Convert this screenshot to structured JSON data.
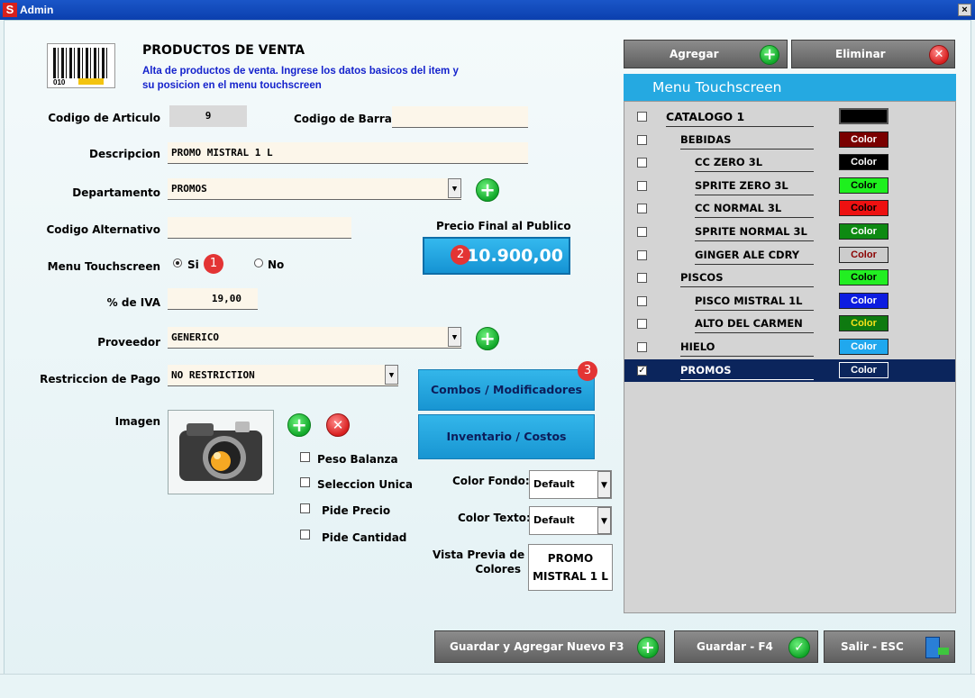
{
  "window": {
    "title": "Admin",
    "close": "×"
  },
  "header": {
    "title": "PRODUCTOS DE VENTA",
    "subtitle": "Alta de productos de venta. Ingrese los datos basicos del item y su posicion en el menu touchscreen",
    "barcode_number": "010"
  },
  "form": {
    "codigo_articulo_label": "Codigo de Articulo",
    "codigo_articulo_value": "9",
    "codigo_barras_label": "Codigo de Barras",
    "codigo_barras_value": "",
    "descripcion_label": "Descripcion",
    "descripcion_value": "PROMO MISTRAL 1 L",
    "departamento_label": "Departamento",
    "departamento_value": "PROMOS",
    "codigo_alternativo_label": "Codigo Alternativo",
    "codigo_alternativo_value": "",
    "precio_label": "Precio Final al Publico",
    "precio_value": "10.900,00",
    "menu_touch_label": "Menu Touchscreen",
    "radio_si": "Si",
    "radio_no": "No",
    "iva_label": "% de IVA",
    "iva_value": "19,00",
    "proveedor_label": "Proveedor",
    "proveedor_value": "GENERICO",
    "restriccion_label": "Restriccion de Pago",
    "restriccion_value": "NO RESTRICTION",
    "imagen_label": "Imagen",
    "combos_button": "Combos /  Modificadores",
    "inventario_button": "Inventario / Costos",
    "checkboxes": [
      "Peso Balanza",
      "Seleccion Unica",
      "Pide Precio",
      "Pide Cantidad"
    ],
    "color_fondo_label": "Color Fondo:",
    "color_fondo_value": "Default",
    "color_texto_label": "Color Texto:",
    "color_texto_value": "Default",
    "vista_previa_label_1": "Vista Previa de",
    "vista_previa_label_2": "Colores",
    "preview_line1": "PROMO",
    "preview_line2": "MISTRAL 1 L"
  },
  "badges": [
    "1",
    "2",
    "3"
  ],
  "right_panel": {
    "agregar": "Agregar",
    "eliminar": "Eliminar",
    "menu_title": "Menu Touchscreen",
    "color_button_label": "Color",
    "items": [
      {
        "label": "CATALOGO 1",
        "level": 0,
        "color": "#000000",
        "text_color": "#000000",
        "checked": false
      },
      {
        "label": "BEBIDAS",
        "level": 1,
        "color": "#7a0000",
        "text_color": "#ffffff",
        "checked": false
      },
      {
        "label": "CC ZERO 3L",
        "level": 2,
        "color": "#000000",
        "text_color": "#ffffff",
        "checked": false
      },
      {
        "label": "SPRITE ZERO 3L",
        "level": 2,
        "color": "#1ef01e",
        "text_color": "#000000",
        "checked": false
      },
      {
        "label": "CC NORMAL 3L",
        "level": 2,
        "color": "#ee1111",
        "text_color": "#000000",
        "checked": false
      },
      {
        "label": "SPRITE NORMAL 3L",
        "level": 2,
        "color": "#0d8a12",
        "text_color": "#ffffff",
        "checked": false
      },
      {
        "label": "GINGER ALE CDRY",
        "level": 2,
        "color": "#cccccc",
        "text_color": "#8a0000",
        "checked": false
      },
      {
        "label": "PISCOS",
        "level": 1,
        "color": "#22ee22",
        "text_color": "#000000",
        "checked": false
      },
      {
        "label": "PISCO MISTRAL 1L",
        "level": 2,
        "color": "#0c1ce0",
        "text_color": "#ffffff",
        "checked": false
      },
      {
        "label": "ALTO DEL CARMEN",
        "level": 2,
        "color": "#0e7a10",
        "text_color": "#f7e21a",
        "checked": false
      },
      {
        "label": "HIELO",
        "level": 1,
        "color": "#20a8ee",
        "text_color": "#ffffff",
        "checked": false
      },
      {
        "label": "PROMOS",
        "level": 1,
        "color": "#0b255c",
        "text_color": "#ffffff",
        "checked": true,
        "selected": true
      }
    ]
  },
  "footer": {
    "guardar_nuevo": "Guardar y Agregar Nuevo F3",
    "guardar": "Guardar - F4",
    "salir": "Salir - ESC"
  }
}
